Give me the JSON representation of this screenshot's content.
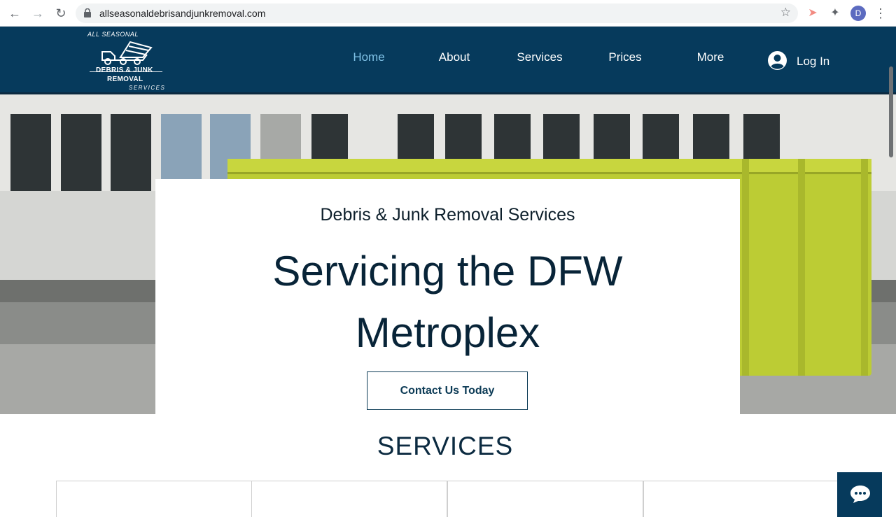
{
  "browser": {
    "url": "allseasonaldebrisandjunkremoval.com",
    "profile_initial": "D"
  },
  "logo": {
    "line1": "ALL SEASONAL",
    "line2": "DEBRIS & JUNK",
    "line3": "REMOVAL",
    "line4": "SERVICES"
  },
  "nav": {
    "items": [
      {
        "label": "Home",
        "active": true
      },
      {
        "label": "About",
        "active": false
      },
      {
        "label": "Services",
        "active": false
      },
      {
        "label": "Prices",
        "active": false
      },
      {
        "label": "More",
        "active": false
      }
    ],
    "login_label": "Log In"
  },
  "hero": {
    "kicker": "Debris & Junk Removal Services",
    "headline_line1": "Servicing the DFW",
    "headline_line2": "Metroplex",
    "cta_label": "Contact Us Today"
  },
  "services": {
    "title": "SERVICES"
  },
  "colors": {
    "header_bg": "#063a5c",
    "active_nav": "#7fc1e6",
    "headline": "#082438",
    "dumpster": "#bccc34"
  }
}
